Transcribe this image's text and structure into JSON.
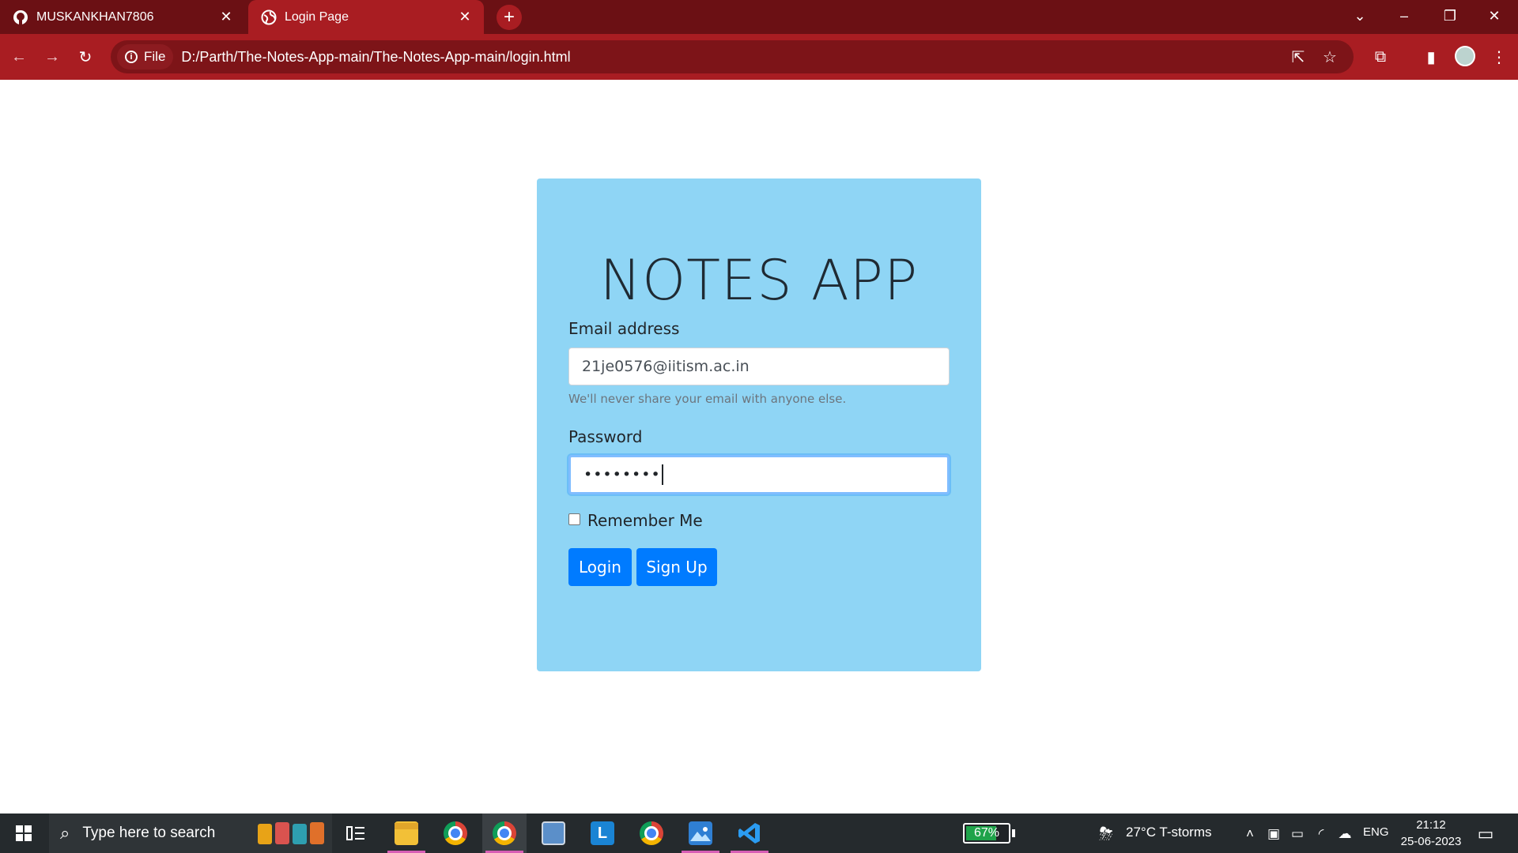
{
  "browser": {
    "tabs": [
      {
        "title": "MUSKANKHAN7806",
        "icon": "github-icon"
      },
      {
        "title": "Login Page",
        "icon": "globe-icon"
      }
    ],
    "address": {
      "scheme_label": "File",
      "url": "D:/Parth/The-Notes-App-main/The-Notes-App-main/login.html"
    },
    "theme_colors": {
      "frame": "#6b1014",
      "toolbar": "#a91d22"
    }
  },
  "page": {
    "title": "NOTES APP",
    "email_label": "Email address",
    "email_value": "21je0576@iitism.ac.in",
    "email_help": "We'll never share your email with anyone else.",
    "password_label": "Password",
    "password_value": "••••••••",
    "remember_label": "Remember Me",
    "remember_checked": false,
    "login_button": "Login",
    "signup_button": "Sign Up",
    "card_color": "#8fd5f5",
    "button_color": "#007bff"
  },
  "taskbar": {
    "search_placeholder": "Type here to search",
    "battery_percent": "67%",
    "weather": "27°C  T-storms",
    "language": "ENG",
    "time": "21:12",
    "date": "25-06-2023"
  }
}
